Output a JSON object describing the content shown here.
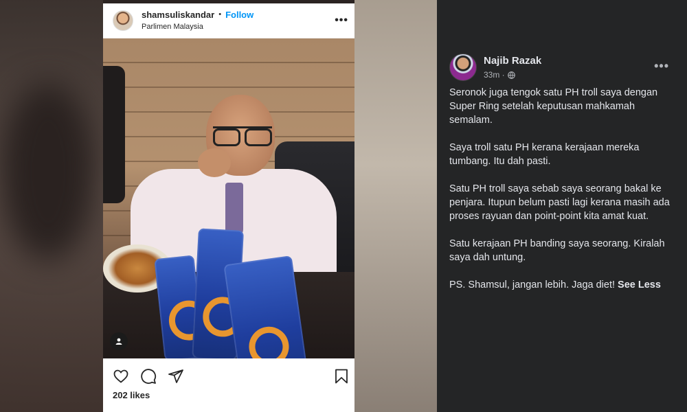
{
  "instagram": {
    "username": "shamsuliskandar",
    "separator": "•",
    "follow_label": "Follow",
    "location": "Parlimen Malaysia",
    "more_icon": "more-horizontal-icon",
    "likes": "202 likes",
    "icons": [
      "heart-icon",
      "comment-icon",
      "share-icon",
      "bookmark-icon"
    ],
    "photo_tag_icon": "user-tag-icon"
  },
  "facebook": {
    "author": "Najib Razak",
    "timestamp": "33m ·",
    "privacy_icon": "globe-icon",
    "more_icon": "more-horizontal-icon",
    "paragraphs": [
      "Seronok juga tengok satu PH troll saya dengan Super Ring setelah keputusan mahkamah semalam.",
      "Saya troll satu PH kerana kerajaan mereka tumbang. Itu dah pasti.",
      "Satu PH troll saya sebab saya seorang bakal ke penjara. Itupun belum pasti lagi kerana masih ada proses rayuan dan point-point kita amat kuat.",
      "Satu kerajaan PH banding saya seorang. Kiralah saya dah untung.",
      "PS. Shamsul, jangan lebih. Jaga diet!"
    ],
    "see_less_label": "See Less"
  },
  "colors": {
    "fb_background": "#242526",
    "fb_text": "#e4e6eb",
    "fb_secondary": "#b0b3b8",
    "ig_follow": "#0095f6",
    "ig_text": "#262626"
  }
}
